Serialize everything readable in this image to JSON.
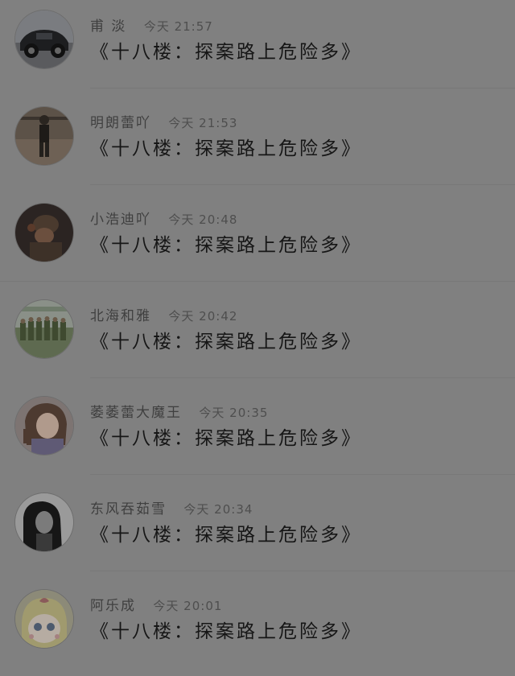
{
  "comments": [
    {
      "name": "甫 淡",
      "time": "今天 21:57",
      "text": "《十八楼：探案路上危险多》",
      "avatar": "car-avatar"
    },
    {
      "name": "明朗蕾吖",
      "time": "今天 21:53",
      "text": "《十八楼：探案路上危险多》",
      "avatar": "person-avatar"
    },
    {
      "name": "小浩迪吖",
      "time": "今天 20:48",
      "text": "《十八楼：探案路上危险多》",
      "avatar": "soldier-avatar"
    },
    {
      "name": "北海和雅",
      "time": "今天 20:42",
      "text": "《十八楼：探案路上危险多》",
      "avatar": "troops-avatar"
    },
    {
      "name": "萎萎蕾大魔王",
      "time": "今天 20:35",
      "text": "《十八楼：探案路上危险多》",
      "avatar": "anime-girl-avatar"
    },
    {
      "name": "东风吞茹雪",
      "time": "今天 20:34",
      "text": "《十八楼：探案路上危险多》",
      "avatar": "woman-portrait-avatar"
    },
    {
      "name": "阿乐成",
      "time": "今天 20:01",
      "text": "《十八楼：探案路上危险多》",
      "avatar": "cartoon-avatar"
    }
  ]
}
